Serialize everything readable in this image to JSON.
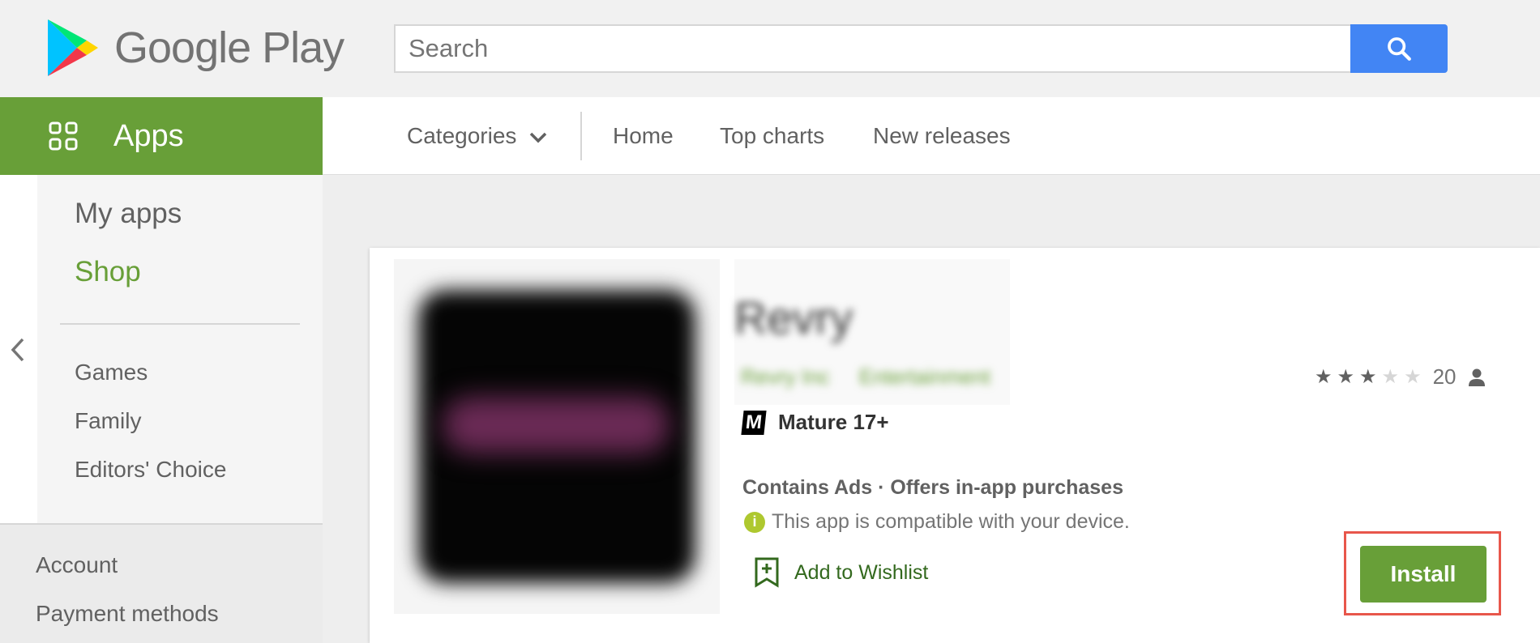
{
  "header": {
    "logo_text": "Google Play",
    "search_placeholder": "Search"
  },
  "nav": {
    "apps_label": "Apps",
    "items": [
      "Categories",
      "Home",
      "Top charts",
      "New releases"
    ]
  },
  "sidebar": {
    "my_apps": "My apps",
    "shop": "Shop",
    "items": [
      "Games",
      "Family",
      "Editors' Choice"
    ],
    "bottom_items": [
      "Account",
      "Payment methods"
    ]
  },
  "app": {
    "title": "Revry",
    "developer": "Revry Inc",
    "category": "Entertainment",
    "rating_stars": 3,
    "rating_max": 5,
    "rating_count": "20",
    "content_rating": "Mature 17+",
    "ads_info": "Contains Ads · Offers in-app purchases",
    "compat_text": "This app is compatible with your device.",
    "wishlist_label": "Add to Wishlist",
    "install_label": "Install"
  },
  "colors": {
    "green": "#689f38",
    "blue": "#4285f4",
    "highlight": "#e8564b"
  }
}
